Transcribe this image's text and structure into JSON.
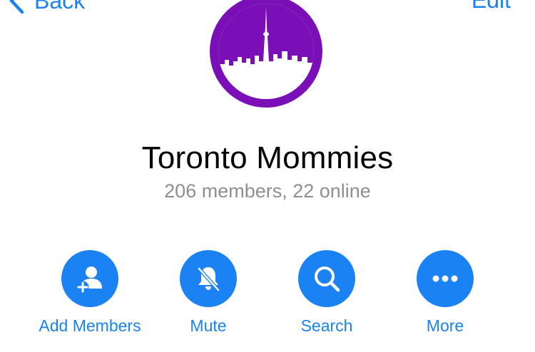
{
  "nav": {
    "back_label": "Back",
    "edit_label": "Edit"
  },
  "group": {
    "title": "Toronto Mommies",
    "subtitle": "206 members, 22 online",
    "avatar_icon": "toronto-skyline-icon"
  },
  "actions": [
    {
      "label": "Add Members",
      "icon": "add-member-icon"
    },
    {
      "label": "Mute",
      "icon": "bell-slash-icon"
    },
    {
      "label": "Search",
      "icon": "search-icon"
    },
    {
      "label": "More",
      "icon": "ellipsis-icon"
    }
  ],
  "colors": {
    "accent": "#1a82f2",
    "avatar_purple": "#7a0fb8",
    "subtitle_gray": "#8e8e93"
  }
}
